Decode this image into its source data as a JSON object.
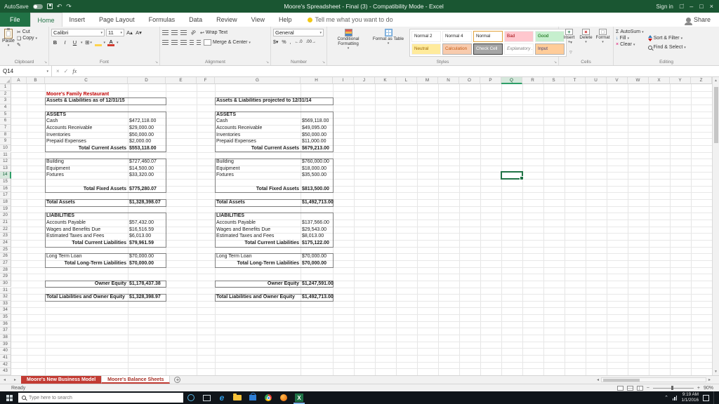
{
  "window": {
    "autosave_label": "AutoSave",
    "title": "Moore's Spreadsheet - Final (3) - Compatibility Mode - Excel",
    "sign_in": "Sign in"
  },
  "ribbon": {
    "tabs": [
      "File",
      "Home",
      "Insert",
      "Page Layout",
      "Formulas",
      "Data",
      "Review",
      "View",
      "Help"
    ],
    "tell_me": "Tell me what you want to do",
    "share": "Share",
    "clipboard": {
      "label": "Clipboard",
      "paste": "Paste",
      "cut": "Cut",
      "copy": "Copy",
      "format_painter": "Format Painter"
    },
    "font": {
      "label": "Font",
      "family": "Calibri",
      "size": "11"
    },
    "alignment": {
      "label": "Alignment",
      "wrap_text": "Wrap Text",
      "merge_center": "Merge & Center"
    },
    "number": {
      "label": "Number",
      "format": "General"
    },
    "styles": {
      "label": "Styles",
      "conditional_formatting": "Conditional Formatting",
      "format_as_table": "Format as Table",
      "cell_styles": [
        "Normal 2",
        "Normal 4",
        "Normal",
        "Bad",
        "Good",
        "Neutral",
        "Calculation",
        "Check Cell",
        "Explanatory ...",
        "Input"
      ]
    },
    "cells": {
      "label": "Cells",
      "insert": "Insert",
      "delete": "Delete",
      "format": "Format"
    },
    "editing": {
      "label": "Editing",
      "autosum": "AutoSum",
      "fill": "Fill",
      "clear": "Clear",
      "sort_filter": "Sort & Filter",
      "find_select": "Find & Select"
    }
  },
  "formula_bar": {
    "name_box": "Q14",
    "fx": "fx"
  },
  "grid": {
    "columns": [
      "A",
      "B",
      "C",
      "D",
      "E",
      "F",
      "G",
      "H",
      "I",
      "J",
      "K",
      "L",
      "M",
      "N",
      "O",
      "P",
      "Q",
      "R",
      "S",
      "T",
      "U",
      "V",
      "W",
      "X",
      "Y",
      "Z"
    ],
    "rows": 43,
    "selected_cell": "Q14",
    "cells": [
      {
        "c": "C",
        "r": 2,
        "t": "Moore's Family Restaurant",
        "s": "red b"
      },
      {
        "c": "C",
        "r": 3,
        "t": "Assets & Liabilities as of 12/31/15",
        "s": "b"
      },
      {
        "c": "G",
        "r": 3,
        "t": "Assets & Liabilities projected to 12/31/14",
        "s": "b"
      },
      {
        "c": "C",
        "r": 5,
        "t": "ASSETS",
        "s": "b"
      },
      {
        "c": "G",
        "r": 5,
        "t": "ASSETS",
        "s": "b"
      },
      {
        "c": "C",
        "r": 6,
        "t": "Cash"
      },
      {
        "c": "D",
        "r": 6,
        "t": "$472,118.00"
      },
      {
        "c": "G",
        "r": 6,
        "t": "Cash"
      },
      {
        "c": "H",
        "r": 6,
        "t": "$569,118.00"
      },
      {
        "c": "C",
        "r": 7,
        "t": "Accounts Receivable"
      },
      {
        "c": "D",
        "r": 7,
        "t": "$29,000.00"
      },
      {
        "c": "G",
        "r": 7,
        "t": "Accounts Receivable"
      },
      {
        "c": "H",
        "r": 7,
        "t": "$49,095.00"
      },
      {
        "c": "C",
        "r": 8,
        "t": "Inventories"
      },
      {
        "c": "D",
        "r": 8,
        "t": "$50,000.00"
      },
      {
        "c": "G",
        "r": 8,
        "t": "Inventories"
      },
      {
        "c": "H",
        "r": 8,
        "t": "$50,000.00"
      },
      {
        "c": "C",
        "r": 9,
        "t": "Prepaid Expenses"
      },
      {
        "c": "D",
        "r": 9,
        "t": "$2,000.00"
      },
      {
        "c": "G",
        "r": 9,
        "t": "Prepaid Expenses"
      },
      {
        "c": "H",
        "r": 9,
        "t": "$11,000.00"
      },
      {
        "c": "C",
        "r": 10,
        "t": "Total Current Assets",
        "s": "r b"
      },
      {
        "c": "D",
        "r": 10,
        "t": "$553,118.00",
        "s": "b"
      },
      {
        "c": "G",
        "r": 10,
        "t": "Total Current Assets",
        "s": "r b"
      },
      {
        "c": "H",
        "r": 10,
        "t": "$679,213.00",
        "s": "b"
      },
      {
        "c": "C",
        "r": 12,
        "t": "Building"
      },
      {
        "c": "D",
        "r": 12,
        "t": "$727,460.07"
      },
      {
        "c": "G",
        "r": 12,
        "t": "Building"
      },
      {
        "c": "H",
        "r": 12,
        "t": "$760,000.00"
      },
      {
        "c": "C",
        "r": 13,
        "t": "Equipment"
      },
      {
        "c": "D",
        "r": 13,
        "t": "$14,500.00"
      },
      {
        "c": "G",
        "r": 13,
        "t": "Equipment"
      },
      {
        "c": "H",
        "r": 13,
        "t": "$18,000.00"
      },
      {
        "c": "C",
        "r": 14,
        "t": "Fixtures"
      },
      {
        "c": "D",
        "r": 14,
        "t": "$33,320.00"
      },
      {
        "c": "G",
        "r": 14,
        "t": "Fixtures"
      },
      {
        "c": "H",
        "r": 14,
        "t": "$35,500.00"
      },
      {
        "c": "C",
        "r": 16,
        "t": "Total Fixed Assets",
        "s": "r b"
      },
      {
        "c": "D",
        "r": 16,
        "t": "$775,280.07",
        "s": "b"
      },
      {
        "c": "G",
        "r": 16,
        "t": "Total Fixed Assets",
        "s": "r b"
      },
      {
        "c": "H",
        "r": 16,
        "t": "$813,500.00",
        "s": "b"
      },
      {
        "c": "C",
        "r": 18,
        "t": "Total Assets",
        "s": "b"
      },
      {
        "c": "D",
        "r": 18,
        "t": "$1,328,398.07",
        "s": "b"
      },
      {
        "c": "G",
        "r": 18,
        "t": "Total Assets",
        "s": "b"
      },
      {
        "c": "H",
        "r": 18,
        "t": "$1,492,713.00",
        "s": "b"
      },
      {
        "c": "C",
        "r": 20,
        "t": "LIABILITIES",
        "s": "b"
      },
      {
        "c": "G",
        "r": 20,
        "t": "LIABILITIES",
        "s": "b"
      },
      {
        "c": "C",
        "r": 21,
        "t": "Accounts Payable"
      },
      {
        "c": "D",
        "r": 21,
        "t": "$57,432.00"
      },
      {
        "c": "G",
        "r": 21,
        "t": "Accounts Payable"
      },
      {
        "c": "H",
        "r": 21,
        "t": "$137,566.00"
      },
      {
        "c": "C",
        "r": 22,
        "t": "Wages and Benefits Due"
      },
      {
        "c": "D",
        "r": 22,
        "t": "$16,516.59"
      },
      {
        "c": "G",
        "r": 22,
        "t": "Wages and Benefits Due"
      },
      {
        "c": "H",
        "r": 22,
        "t": "$29,543.00"
      },
      {
        "c": "C",
        "r": 23,
        "t": "Estimated Taxes and Fees"
      },
      {
        "c": "D",
        "r": 23,
        "t": "$6,013.00"
      },
      {
        "c": "G",
        "r": 23,
        "t": "Estimated Taxes and Fees"
      },
      {
        "c": "H",
        "r": 23,
        "t": "$8,013.00"
      },
      {
        "c": "C",
        "r": 24,
        "t": "Total Current Liabilities",
        "s": "r b"
      },
      {
        "c": "D",
        "r": 24,
        "t": "$79,961.59",
        "s": "b"
      },
      {
        "c": "G",
        "r": 24,
        "t": "Total Current Liabilities",
        "s": "r b"
      },
      {
        "c": "H",
        "r": 24,
        "t": "$175,122.00",
        "s": "b"
      },
      {
        "c": "C",
        "r": 26,
        "t": "Long Term Loan"
      },
      {
        "c": "D",
        "r": 26,
        "t": "$70,000.00"
      },
      {
        "c": "G",
        "r": 26,
        "t": "Long Term Loan"
      },
      {
        "c": "H",
        "r": 26,
        "t": "$70,000.00"
      },
      {
        "c": "C",
        "r": 27,
        "t": "Total Long-Term Liabilities",
        "s": "r b"
      },
      {
        "c": "D",
        "r": 27,
        "t": "$70,000.00",
        "s": "b"
      },
      {
        "c": "G",
        "r": 27,
        "t": "Total Long-Term Liabilities",
        "s": "r b"
      },
      {
        "c": "H",
        "r": 27,
        "t": "$70,000.00",
        "s": "b"
      },
      {
        "c": "C",
        "r": 30,
        "t": "Owner Equity",
        "s": "r b"
      },
      {
        "c": "D",
        "r": 30,
        "t": "$1,178,437.38",
        "s": "b"
      },
      {
        "c": "G",
        "r": 30,
        "t": "Owner Equity",
        "s": "r b"
      },
      {
        "c": "H",
        "r": 30,
        "t": "$1,247,591.00",
        "s": "b"
      },
      {
        "c": "C",
        "r": 32,
        "t": "Total Liabilities and Owner Equity",
        "s": "b"
      },
      {
        "c": "D",
        "r": 32,
        "t": "$1,328,398.97",
        "s": "b"
      },
      {
        "c": "G",
        "r": 32,
        "t": "Total Liabilities and Owner Equity",
        "s": "b"
      },
      {
        "c": "H",
        "r": 32,
        "t": "$1,492,713.00",
        "s": "b"
      }
    ],
    "boxes": [
      {
        "c1": "C",
        "c2": "D",
        "r1": 3,
        "r2": 3
      },
      {
        "c1": "G",
        "c2": "H",
        "r1": 3,
        "r2": 3
      },
      {
        "c1": "C",
        "c2": "D",
        "r1": 5,
        "r2": 10
      },
      {
        "c1": "G",
        "c2": "H",
        "r1": 5,
        "r2": 10
      },
      {
        "c1": "C",
        "c2": "D",
        "r1": 12,
        "r2": 16
      },
      {
        "c1": "G",
        "c2": "H",
        "r1": 12,
        "r2": 16
      },
      {
        "c1": "C",
        "c2": "D",
        "r1": 18,
        "r2": 18
      },
      {
        "c1": "G",
        "c2": "H",
        "r1": 18,
        "r2": 18
      },
      {
        "c1": "C",
        "c2": "D",
        "r1": 20,
        "r2": 24
      },
      {
        "c1": "G",
        "c2": "H",
        "r1": 20,
        "r2": 24
      },
      {
        "c1": "C",
        "c2": "D",
        "r1": 26,
        "r2": 27
      },
      {
        "c1": "G",
        "c2": "H",
        "r1": 26,
        "r2": 27
      },
      {
        "c1": "C",
        "c2": "D",
        "r1": 30,
        "r2": 30
      },
      {
        "c1": "G",
        "c2": "H",
        "r1": 30,
        "r2": 30
      },
      {
        "c1": "C",
        "c2": "D",
        "r1": 32,
        "r2": 32
      },
      {
        "c1": "G",
        "c2": "H",
        "r1": 32,
        "r2": 32
      }
    ]
  },
  "sheet_tabs": {
    "tabs": [
      {
        "label": "Moore's New Business Model",
        "active": false
      },
      {
        "label": "Moore's Balance Sheets",
        "active": true
      }
    ]
  },
  "status_bar": {
    "mode": "Ready",
    "zoom": "90%"
  },
  "taskbar": {
    "search_placeholder": "Type here to search",
    "time": "9:19 AM",
    "date": "1/1/2016"
  }
}
